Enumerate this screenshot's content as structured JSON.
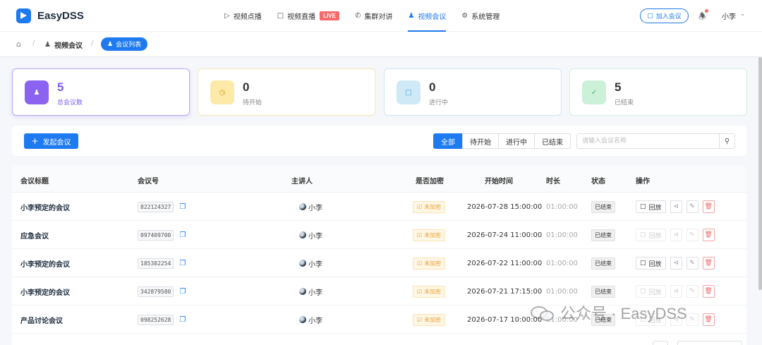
{
  "app": {
    "name": "EasyDSS"
  },
  "nav": {
    "items": [
      {
        "label": "视频点播",
        "icon": "play-circle-icon"
      },
      {
        "label": "视频直播",
        "icon": "video-camera-icon",
        "badge": "LIVE"
      },
      {
        "label": "集群对讲",
        "icon": "phone-icon"
      },
      {
        "label": "视频会议",
        "icon": "people-icon",
        "active": true
      },
      {
        "label": "系统管理",
        "icon": "gear-icon"
      }
    ],
    "join_label": "加入会议",
    "user": "小李"
  },
  "breadcrumb": {
    "sep": "/",
    "parent": "视频会议",
    "current": "会议列表"
  },
  "stats": [
    {
      "value": "5",
      "label": "总会议数",
      "color": "#7c5cf0"
    },
    {
      "value": "0",
      "label": "待开始",
      "color": "#e6a23c"
    },
    {
      "value": "0",
      "label": "进行中",
      "color": "#3aa7d6"
    },
    {
      "value": "5",
      "label": "已结束",
      "color": "#3cb371"
    }
  ],
  "toolbar": {
    "start_label": "发起会议",
    "filters": [
      "全部",
      "待开始",
      "进行中",
      "已结束"
    ],
    "active_filter": "全部",
    "search_placeholder": "请输入会议名称"
  },
  "table": {
    "headers": [
      "会议标题",
      "会议号",
      "主讲人",
      "是否加密",
      "开始时间",
      "时长",
      "状态",
      "操作"
    ],
    "play_label": "回放",
    "rows": [
      {
        "title": "小李预定的会议",
        "code": "822124327",
        "host": "小李",
        "enc": "未加密",
        "start": "2026-07-28 15:00:00",
        "dur": "01:00:00",
        "status": "已结束",
        "play_enabled": true
      },
      {
        "title": "应急会议",
        "code": "097409700",
        "host": "小李",
        "enc": "未加密",
        "start": "2026-07-24 11:00:00",
        "dur": "01:00:00",
        "status": "已结束",
        "play_enabled": false
      },
      {
        "title": "小李预定的会议",
        "code": "185382254",
        "host": "小李",
        "enc": "未加密",
        "start": "2026-07-22 11:00:00",
        "dur": "01:00:00",
        "status": "已结束",
        "play_enabled": true
      },
      {
        "title": "小李预定的会议",
        "code": "342879580",
        "host": "小李",
        "enc": "未加密",
        "start": "2026-07-21 17:15:00",
        "dur": "01:00:00",
        "status": "已结束",
        "play_enabled": false
      },
      {
        "title": "产品讨论会议",
        "code": "098252628",
        "host": "小李",
        "enc": "未加密",
        "start": "2026-07-17 10:00:00",
        "dur": "01:00:00",
        "status": "已结束",
        "play_enabled": false
      }
    ]
  },
  "watermark": {
    "text": "公众号 · EasyDSS"
  }
}
